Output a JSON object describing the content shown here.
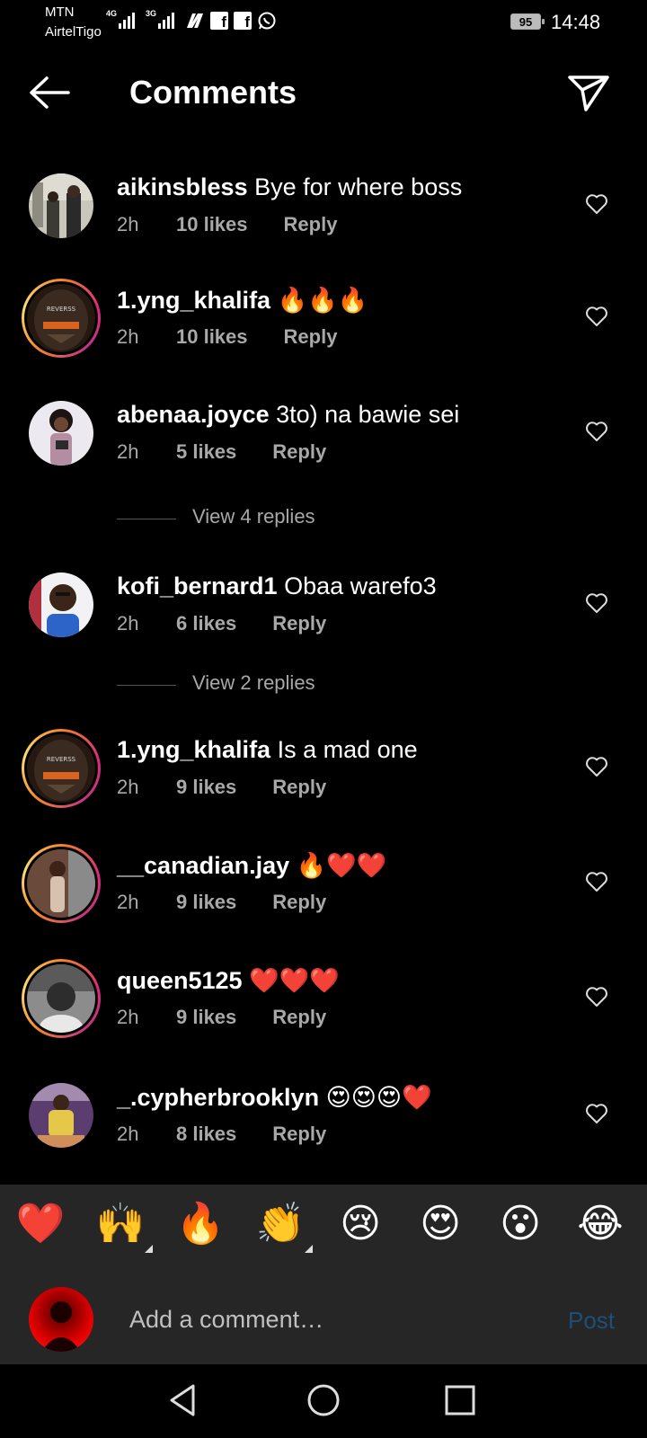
{
  "status": {
    "carrier1": "MTN",
    "carrier2": "AirtelTigo",
    "signal1_tech": "4G",
    "signal2_tech": "3G",
    "battery": "95",
    "time": "14:48"
  },
  "header": {
    "title": "Comments"
  },
  "comments": [
    {
      "user": "aikinsbless",
      "text": "Bye for where boss",
      "time": "2h",
      "likes": "10 likes",
      "reply": "Reply"
    },
    {
      "user": "1.yng_khalifa",
      "text": "🔥🔥🔥",
      "time": "2h",
      "likes": "10 likes",
      "reply": "Reply"
    },
    {
      "user": "abenaa.joyce",
      "text": "3to) na bawie sei",
      "time": "2h",
      "likes": "5 likes",
      "reply": "Reply"
    },
    {
      "user": "kofi_bernard1",
      "text": "Obaa warefo3",
      "time": "2h",
      "likes": "6 likes",
      "reply": "Reply"
    },
    {
      "user": "1.yng_khalifa",
      "text": "Is a mad one",
      "time": "2h",
      "likes": "9 likes",
      "reply": "Reply"
    },
    {
      "user": "__canadian.jay",
      "text": "🔥❤️❤️",
      "time": "2h",
      "likes": "9 likes",
      "reply": "Reply"
    },
    {
      "user": "queen5125",
      "text": "❤️❤️❤️",
      "time": "2h",
      "likes": "9 likes",
      "reply": "Reply"
    },
    {
      "user": "_.cypherbrooklyn",
      "text": "😍😍😍❤️",
      "time": "2h",
      "likes": "8 likes",
      "reply": "Reply"
    }
  ],
  "view_replies": [
    {
      "label": "View 4 replies"
    },
    {
      "label": "View 2 replies"
    }
  ],
  "emoji_bar": [
    "❤️",
    "🙌",
    "🔥",
    "👏",
    "😢",
    "😍",
    "😮",
    "😂"
  ],
  "composer": {
    "placeholder": "Add a comment…",
    "post_label": "Post"
  },
  "icons": {
    "back": "arrow-left-icon",
    "send": "paper-plane-icon",
    "like": "heart-outline-icon",
    "nav_back": "triangle-back-icon",
    "nav_home": "circle-home-icon",
    "nav_recent": "square-recent-icon"
  },
  "colors": {
    "background": "#000000",
    "composer_bg": "#262626",
    "meta_text": "#a8a8a8",
    "post_disabled": "#1e4f7a"
  }
}
